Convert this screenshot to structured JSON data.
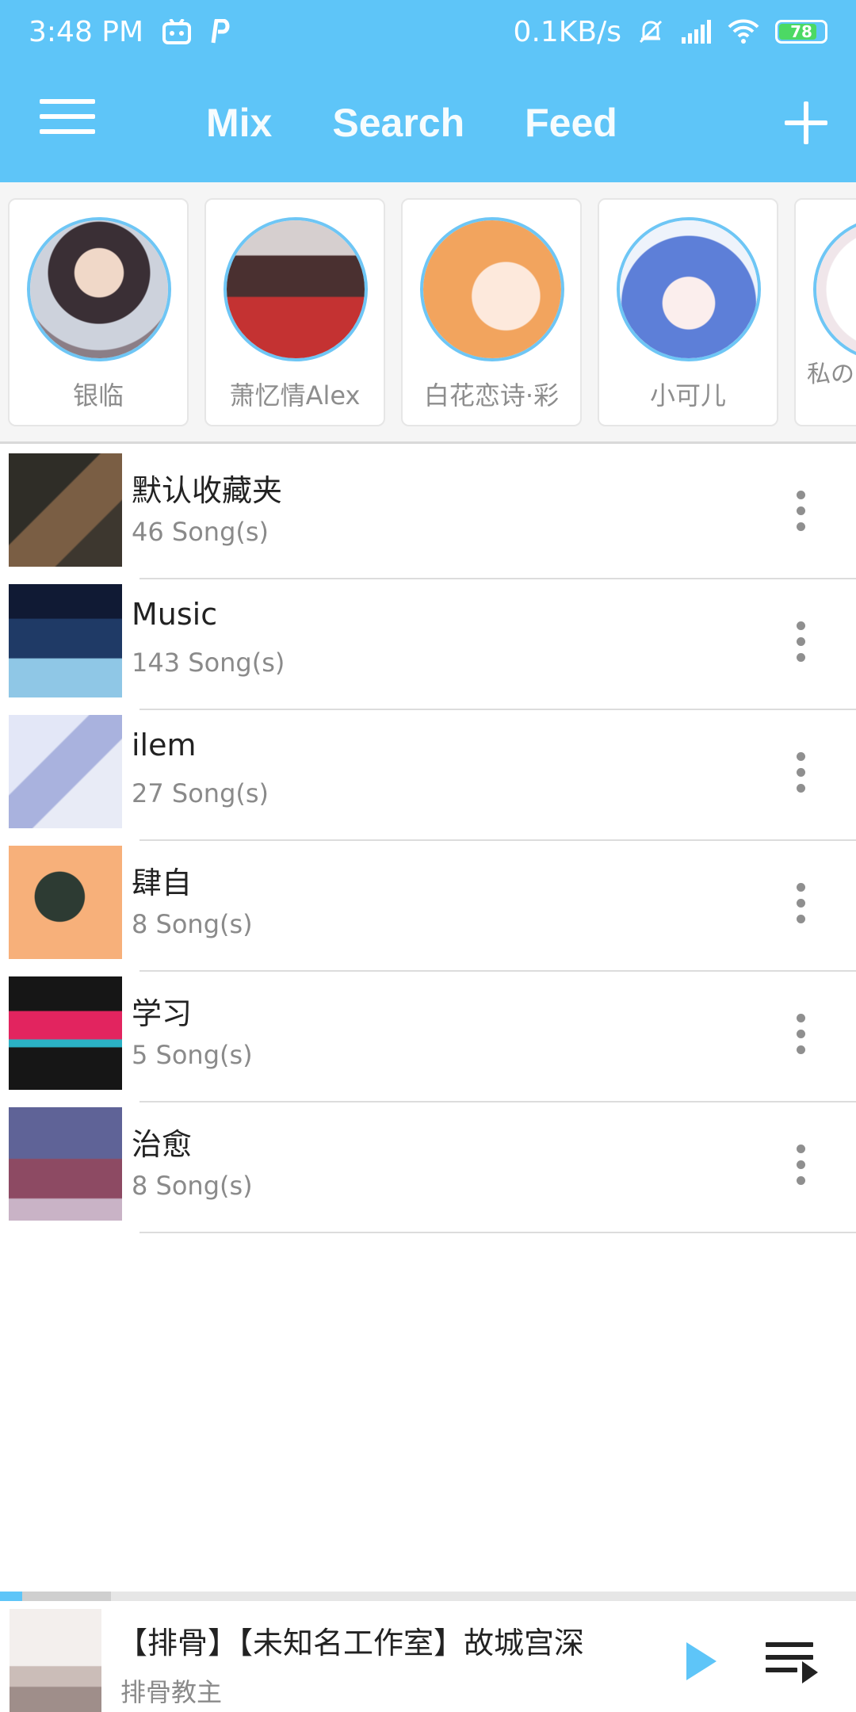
{
  "status_bar": {
    "time": "3:48 PM",
    "network_speed": "0.1KB/s",
    "battery": "78",
    "icons": [
      "robot-icon",
      "p-icon",
      "mute-bell-icon",
      "signal-icon",
      "wifi-icon",
      "battery-icon"
    ]
  },
  "header": {
    "tabs": [
      "Mix",
      "Search",
      "Feed"
    ],
    "active_tab": "Mix",
    "colors": {
      "primary": "#5ec5f8",
      "text": "#ffffff"
    }
  },
  "friends": [
    {
      "name": "银临",
      "avatar_color": "#7b6f80"
    },
    {
      "name": "萧忆情Alex",
      "avatar_color": "#b43b3b"
    },
    {
      "name": "白花恋诗·彩",
      "avatar_color": "#f0a25c"
    },
    {
      "name": "小可儿",
      "avatar_color": "#5b7cd6"
    },
    {
      "name": "私の\nス具",
      "avatar_color": "#f2eef0"
    }
  ],
  "playlists": [
    {
      "title": "默认收藏夹",
      "count": "46 Song(s)",
      "thumb_colors": [
        "#3a3a34",
        "#8a6c4c"
      ]
    },
    {
      "title": "Music",
      "count": "143 Song(s)",
      "thumb_colors": [
        "#1d2b4f",
        "#76b6d9"
      ]
    },
    {
      "title": "ilem",
      "count": "27 Song(s)",
      "thumb_colors": [
        "#d9def2",
        "#9aa6d8"
      ]
    },
    {
      "title": "肆自",
      "count": "8 Song(s)",
      "thumb_colors": [
        "#f7b07a",
        "#2c3b33"
      ]
    },
    {
      "title": "学习",
      "count": "5 Song(s)",
      "thumb_colors": [
        "#1a1a1a",
        "#e2245f"
      ]
    },
    {
      "title": "治愈",
      "count": "8 Song(s)",
      "thumb_colors": [
        "#6a6ea3",
        "#b4506a"
      ]
    }
  ],
  "player": {
    "song": "【排骨】【未知名工作室】故城宫深",
    "artist": "排骨教主",
    "progress": 0.026,
    "buffered": 0.13,
    "cover_colors": [
      "#efeae8",
      "#c9b9b5"
    ]
  }
}
